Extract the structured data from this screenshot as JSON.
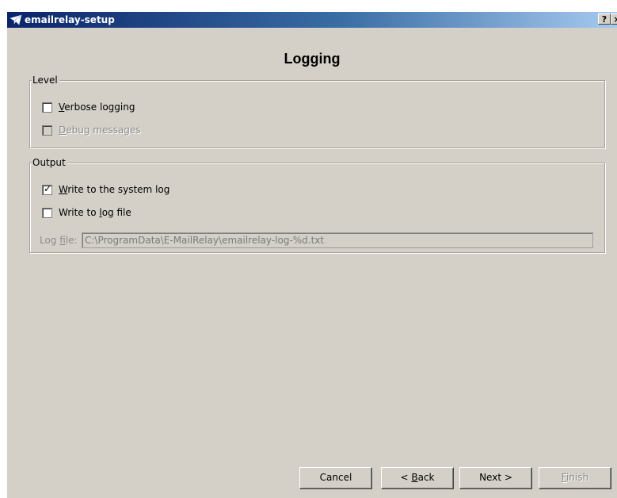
{
  "window": {
    "title": "emailrelay-setup",
    "help_glyph": "?",
    "close_glyph": "×",
    "icon": "email-envelope-icon"
  },
  "page": {
    "title": "Logging"
  },
  "level": {
    "legend": "Level",
    "verbose": {
      "label_mnemonic": "V",
      "label_rest": "erbose logging",
      "checked": false,
      "enabled": true
    },
    "debug": {
      "label_mnemonic": "D",
      "label_rest": "ebug messages",
      "checked": false,
      "enabled": false
    }
  },
  "output": {
    "legend": "Output",
    "system_log": {
      "label_mnemonic": "W",
      "label_rest": "rite to the system log",
      "checked": true,
      "enabled": true
    },
    "log_file": {
      "label_pre": "Write to ",
      "label_mnemonic": "l",
      "label_rest": "og file",
      "checked": false,
      "enabled": true
    },
    "log_file_field": {
      "label_pre": "Log ",
      "label_mnemonic": "f",
      "label_rest": "ile:",
      "value": "C:\\ProgramData\\E-MailRelay\\emailrelay-log-%d.txt",
      "enabled": false
    }
  },
  "buttons": {
    "cancel": "Cancel",
    "back_pre": "< ",
    "back_mnemonic": "B",
    "back_rest": "ack",
    "next": "Next >",
    "finish_mnemonic": "F",
    "finish_rest": "inish"
  },
  "check_glyph": "✓"
}
